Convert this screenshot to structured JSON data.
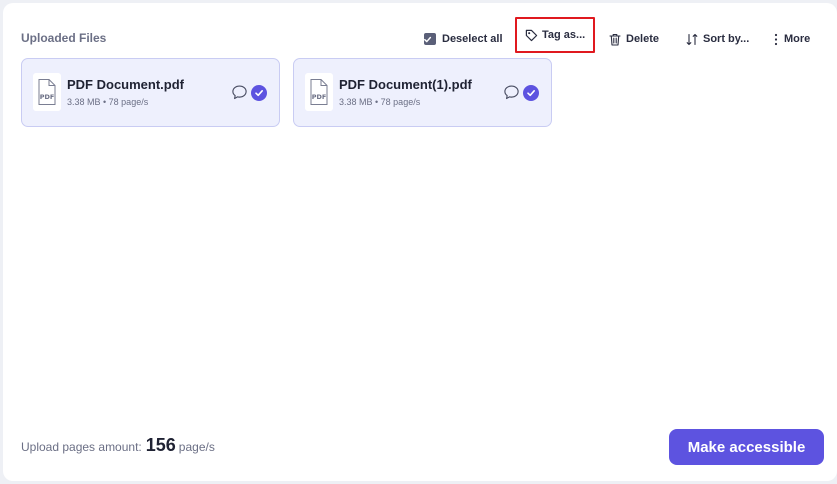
{
  "header": {
    "title": "Uploaded Files"
  },
  "toolbar": {
    "deselect_label": "Deselect all",
    "tag_label": "Tag as...",
    "delete_label": "Delete",
    "sort_label": "Sort by...",
    "more_label": "More"
  },
  "files": [
    {
      "name": "PDF Document.pdf",
      "meta": "3.38 MB • 78 page/s",
      "icon_label": "PDF"
    },
    {
      "name": "PDF Document(1).pdf",
      "meta": "3.38 MB • 78 page/s",
      "icon_label": "PDF"
    }
  ],
  "footer": {
    "amount_label": "Upload pages amount:",
    "amount_value": "156",
    "amount_unit": "page/s",
    "primary_action": "Make accessible"
  },
  "colors": {
    "accent": "#5d53e0",
    "card_bg": "#eef0fd",
    "card_border": "#c9ccf3",
    "highlight": "#e0191f"
  }
}
